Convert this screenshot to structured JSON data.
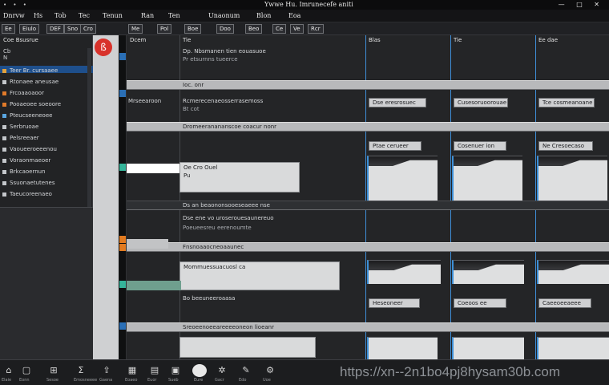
{
  "window": {
    "title": "Ywwe Hu. Imrunecefe aniti",
    "controls": [
      "—",
      "□",
      "✕"
    ],
    "dots": "• • •"
  },
  "menubar": {
    "items": [
      "Dnrvw",
      "Hs",
      "Tob",
      "Tec",
      "Tenun",
      "Ran",
      "Ten",
      "Unaonum",
      "Blon",
      "Eoa"
    ]
  },
  "toolbar": {
    "buttons": [
      "Ee",
      "Eiulo",
      "DEF",
      "Sno",
      "Cro",
      "Me",
      "Pol",
      "Boe",
      "Doo",
      "Beo",
      "Ce",
      "Ve",
      "Rcr"
    ]
  },
  "left_panel": {
    "header": "Coe Bsusrue",
    "tree_lines": [
      "Cb",
      "N"
    ],
    "items": [
      {
        "label": "Teer  Br. cursaaee",
        "color": "#e2a13c"
      },
      {
        "label": "Rtonaee aneusae",
        "color": "#c3c6ca"
      },
      {
        "label": "Frcoaaoaoor",
        "color": "#e07a2a"
      },
      {
        "label": "Pooaeoee soeoore",
        "color": "#e07a2a"
      },
      {
        "label": "Pteucseeneoee",
        "color": "#5aa6e0"
      },
      {
        "label": "Serbruoae",
        "color": "#c3c6ca"
      },
      {
        "label": "Pelsreeaer",
        "color": "#c3c6ca"
      },
      {
        "label": "Vaoueeroeeenou",
        "color": "#c3c6ca"
      },
      {
        "label": "Voraonmaeoer",
        "color": "#c3c6ca"
      },
      {
        "label": "Brkcaoernun",
        "color": "#c3c6ca"
      },
      {
        "label": "Ssuonaetutenes",
        "color": "#c3c6ca"
      },
      {
        "label": "Taeucoreenaeo",
        "color": "#c3c6ca"
      }
    ]
  },
  "record_button": {
    "symbol": "ß"
  },
  "columns": [
    {
      "label": "Dcem"
    },
    {
      "label": "Tie"
    },
    {
      "label": "Blas"
    },
    {
      "label": "Tie"
    },
    {
      "label": "Ee dae"
    }
  ],
  "rows": [
    {
      "band": "Ioc. onr",
      "lines": [
        "Dp. Nbsmanen tien eouasuoe",
        "Pr etsurnns tueerce"
      ]
    },
    {
      "band": "Dromeeranananscoe coacur nonr",
      "lines": [
        "Mrseearoon",
        "Bt cot",
        "Rcmerecenaeosserrasemoss"
      ]
    },
    {
      "band": "Ds an beaononsooeseaeee nse",
      "lines": [
        "Oe Cro Ouel",
        "Pu"
      ]
    },
    {
      "band": "Fnsnoaaocneoaaunec",
      "lines": [
        "Dse ene vo uroserouesaunereuo",
        "Poeueesreu eerenoumte"
      ]
    },
    {
      "band": "Sreoeenoeeareeeeoneon  lioeanr",
      "lines": [
        "Mommuessuacuosl ca",
        "Bo beeuneeroaasa"
      ]
    }
  ],
  "cards": {
    "row2": [
      "Dse eresrosuec",
      "Cusesoruoorouae",
      "Tce cosmeanoane"
    ],
    "row3": [
      "Ptae cerueer",
      "Cosenuer ion",
      "Ne Cresoecaso"
    ],
    "row4": [
      "Heseoneer",
      "Coeoos ee",
      "Caeeoeeaeee"
    ]
  },
  "bottom_bar": {
    "icons": [
      {
        "name": "home-icon",
        "glyph": "⌂",
        "label": "Elaie"
      },
      {
        "name": "box-icon",
        "glyph": "▢",
        "label": "Eonn"
      },
      {
        "name": "library-icon",
        "glyph": "⊞",
        "label": "Sesoe"
      },
      {
        "name": "sigma-icon",
        "glyph": "Σ",
        "label": "Emosneeee"
      },
      {
        "name": "upload-icon",
        "glyph": "⇪",
        "label": "Gaena"
      },
      {
        "name": "film-icon",
        "glyph": "▦",
        "label": "Eoaeo"
      },
      {
        "name": "grid-icon",
        "glyph": "▤",
        "label": "Euor"
      },
      {
        "name": "doc-icon",
        "glyph": "▣",
        "label": "Sueb"
      },
      {
        "name": "mic-icon",
        "glyph": "◙",
        "label": "Eure"
      },
      {
        "name": "gear-icon",
        "glyph": "✲",
        "label": "Gacr"
      },
      {
        "name": "edit-icon",
        "glyph": "✎",
        "label": "Edo"
      },
      {
        "name": "settings-icon",
        "glyph": "⚙",
        "label": "Uoe"
      }
    ],
    "watermark": "https://xn--2n1bo4pj8hysam30b.com"
  }
}
